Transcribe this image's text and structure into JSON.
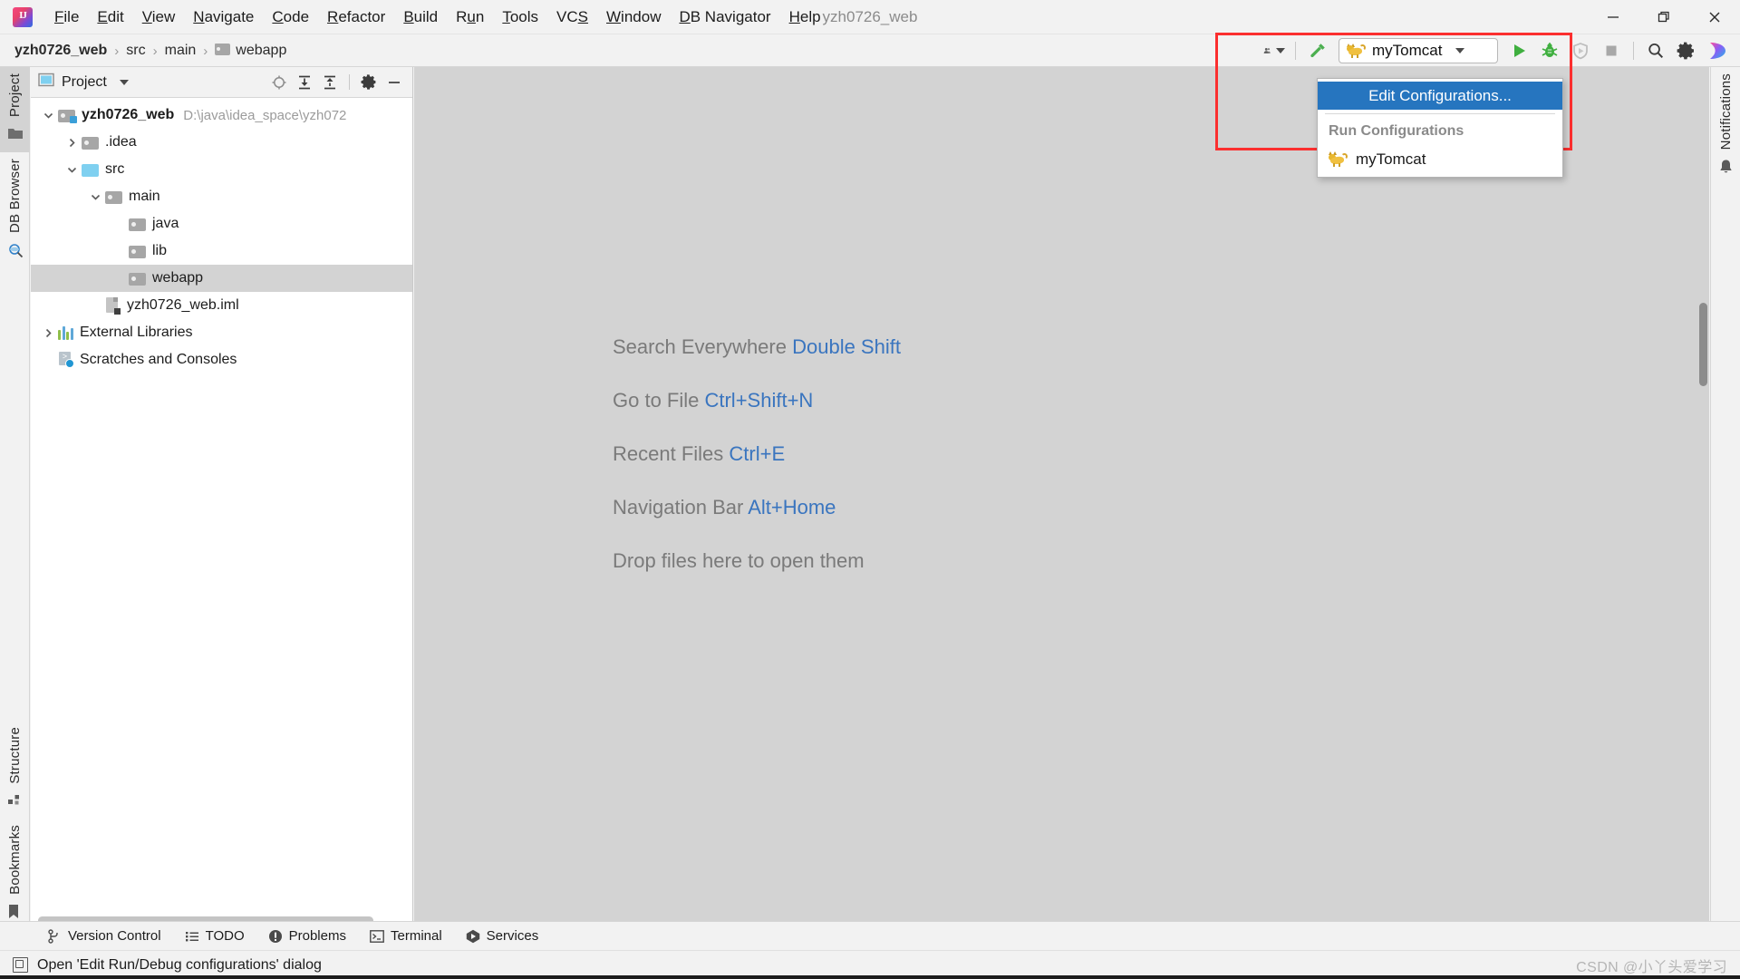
{
  "window": {
    "title": "yzh0726_web",
    "logo_text": "IJ",
    "controls": [
      {
        "name": "minimize",
        "glyph": "minimize-icon"
      },
      {
        "name": "maximize",
        "glyph": "maximize-icon"
      },
      {
        "name": "close",
        "glyph": "close-icon"
      }
    ]
  },
  "menubar": {
    "items": [
      {
        "label": "File",
        "mnemonic": "F"
      },
      {
        "label": "Edit",
        "mnemonic": "E"
      },
      {
        "label": "View",
        "mnemonic": "V"
      },
      {
        "label": "Navigate",
        "mnemonic": "N"
      },
      {
        "label": "Code",
        "mnemonic": "C"
      },
      {
        "label": "Refactor",
        "mnemonic": "R"
      },
      {
        "label": "Build",
        "mnemonic": "B"
      },
      {
        "label": "Run",
        "mnemonic": "u"
      },
      {
        "label": "Tools",
        "mnemonic": "T"
      },
      {
        "label": "VCS",
        "mnemonic": "S"
      },
      {
        "label": "Window",
        "mnemonic": "W"
      },
      {
        "label": "DB Navigator",
        "mnemonic": "D"
      },
      {
        "label": "Help",
        "mnemonic": "H"
      }
    ]
  },
  "breadcrumb": {
    "items": [
      "yzh0726_web",
      "src",
      "main",
      "webapp"
    ],
    "separator": "›"
  },
  "toolbar": {
    "avatar_label": "user-avatar",
    "build_label": "build-hammer",
    "run_config": {
      "name": "myTomcat",
      "icon": "tomcat-icon"
    },
    "buttons": [
      {
        "name": "run-button",
        "icon": "play-icon",
        "color": "#3faf3f",
        "enabled": true
      },
      {
        "name": "debug-button",
        "icon": "bug-icon",
        "color": "#3faf3f",
        "enabled": true
      },
      {
        "name": "coverage-button",
        "icon": "shield-run-icon",
        "color": "#b9b9b9",
        "enabled": false
      },
      {
        "name": "stop-button",
        "icon": "stop-square-icon",
        "color": "#a8a8a8",
        "enabled": false
      },
      {
        "name": "search-button",
        "icon": "search-icon",
        "color": "#3c3c3c",
        "enabled": true
      },
      {
        "name": "settings-button",
        "icon": "gear-icon",
        "color": "#3c3c3c",
        "enabled": true
      },
      {
        "name": "ide-assistant-button",
        "icon": "colorful-play-icon",
        "color": "#2f9bdc",
        "enabled": true
      }
    ]
  },
  "run_config_dropdown": {
    "highlighted_item": "Edit Configurations...",
    "group_header": "Run Configurations",
    "entries": [
      {
        "label": "myTomcat",
        "icon": "tomcat-icon"
      }
    ]
  },
  "left_rail": {
    "top_items": [
      {
        "label": "Project",
        "icon": "project-folder-icon",
        "active": true
      },
      {
        "label": "DB Browser",
        "icon": "db-browser-icon",
        "active": false
      }
    ],
    "bottom_items": [
      {
        "label": "Structure",
        "icon": "structure-icon",
        "active": false
      },
      {
        "label": "Bookmarks",
        "icon": "bookmark-icon",
        "active": false
      }
    ]
  },
  "right_rail": {
    "items": [
      {
        "label": "Notifications",
        "icon": "bell-icon",
        "active": false
      }
    ]
  },
  "project_panel": {
    "title": "Project",
    "header_icons": [
      {
        "name": "select-opened-file-icon"
      },
      {
        "name": "expand-all-icon"
      },
      {
        "name": "collapse-all-icon"
      },
      {
        "name": "gear-icon"
      },
      {
        "name": "hide-icon"
      }
    ],
    "tree": [
      {
        "label": "yzh0726_web",
        "secondary": "D:\\java\\idea_space\\yzh072",
        "indent": 0,
        "twisty": "open",
        "icon": "module-folder-icon",
        "bold": true,
        "selected": false
      },
      {
        "label": ".idea",
        "secondary": "",
        "indent": 1,
        "twisty": "closed",
        "icon": "folder-gray-icon",
        "bold": false,
        "selected": false
      },
      {
        "label": "src",
        "secondary": "",
        "indent": 1,
        "twisty": "open",
        "icon": "folder-blue-icon",
        "bold": false,
        "selected": false
      },
      {
        "label": "main",
        "secondary": "",
        "indent": 2,
        "twisty": "open",
        "icon": "folder-gray-icon",
        "bold": false,
        "selected": false
      },
      {
        "label": "java",
        "secondary": "",
        "indent": 3,
        "twisty": "none",
        "icon": "folder-gray-icon",
        "bold": false,
        "selected": false
      },
      {
        "label": "lib",
        "secondary": "",
        "indent": 3,
        "twisty": "none",
        "icon": "folder-gray-icon",
        "bold": false,
        "selected": false
      },
      {
        "label": "webapp",
        "secondary": "",
        "indent": 3,
        "twisty": "none",
        "icon": "folder-gray-icon",
        "bold": false,
        "selected": true
      },
      {
        "label": "yzh0726_web.iml",
        "secondary": "",
        "indent": 2,
        "twisty": "none",
        "icon": "iml-file-icon",
        "bold": false,
        "selected": false
      },
      {
        "label": "External Libraries",
        "secondary": "",
        "indent": 0,
        "twisty": "closed",
        "icon": "libraries-icon",
        "bold": false,
        "selected": false
      },
      {
        "label": "Scratches and Consoles",
        "secondary": "",
        "indent": 0,
        "twisty": "none",
        "icon": "scratches-icon",
        "bold": false,
        "selected": false
      }
    ]
  },
  "welcome": {
    "lines": [
      {
        "text": "Search Everywhere ",
        "key": "Double Shift"
      },
      {
        "text": "Go to File ",
        "key": "Ctrl+Shift+N"
      },
      {
        "text": "Recent Files ",
        "key": "Ctrl+E"
      },
      {
        "text": "Navigation Bar ",
        "key": "Alt+Home"
      },
      {
        "text": "Drop files here to open them",
        "key": ""
      }
    ]
  },
  "bottom_tools": [
    {
      "label": "Version Control",
      "icon": "branch-icon"
    },
    {
      "label": "TODO",
      "icon": "list-icon"
    },
    {
      "label": "Problems",
      "icon": "error-icon"
    },
    {
      "label": "Terminal",
      "icon": "terminal-icon"
    },
    {
      "label": "Services",
      "icon": "services-icon"
    }
  ],
  "status_bar": {
    "message": "Open 'Edit Run/Debug configurations' dialog",
    "watermark": "CSDN @小丫头爱学习"
  },
  "colors": {
    "accent_blue": "#2675bf",
    "link_blue": "#3a75bf",
    "highlight_red": "#fb2f2f",
    "selection_gray": "#d3d3d3",
    "editor_bg": "#d3d3d3"
  }
}
